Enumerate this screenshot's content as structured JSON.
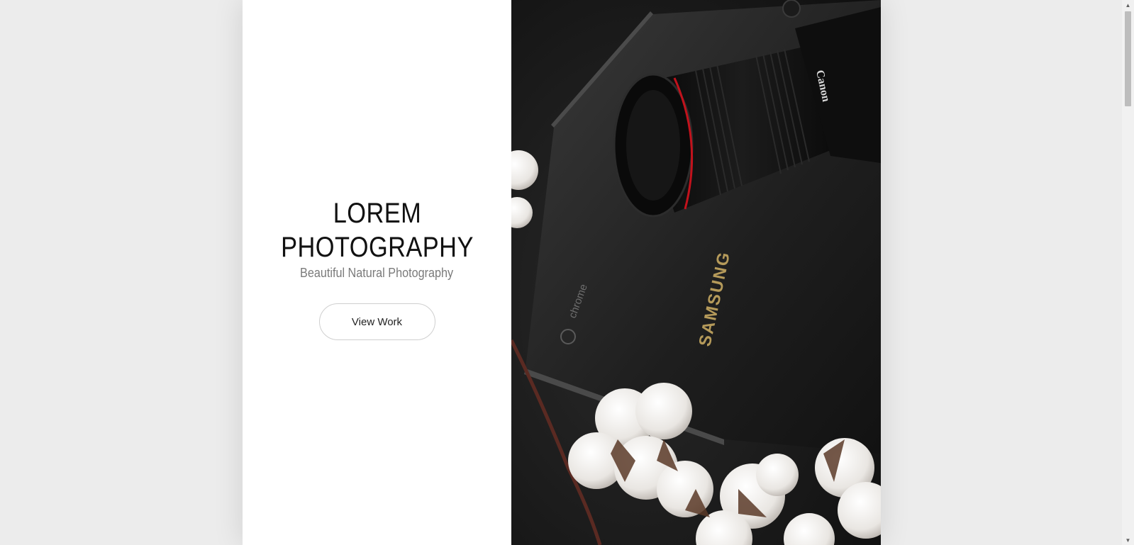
{
  "hero": {
    "title_line1": "LOREM",
    "title_line2": "PHOTOGRAPHY",
    "subtitle": "Beautiful Natural Photography",
    "button_label": "View Work"
  },
  "photo": {
    "subject": "camera-lens-laptop-cotton-photo",
    "lens_brand": "Canon",
    "laptop_brand": "SAMSUNG",
    "laptop_os": "chrome"
  },
  "colors": {
    "page_background": "#ececec",
    "panel_background": "#ffffff",
    "title_color": "#111111",
    "subtitle_color": "#7a7a7a",
    "button_border": "#cfcfcf"
  },
  "icons": {
    "scroll_up": "scroll-up-arrow-icon",
    "scroll_down": "scroll-down-arrow-icon"
  }
}
